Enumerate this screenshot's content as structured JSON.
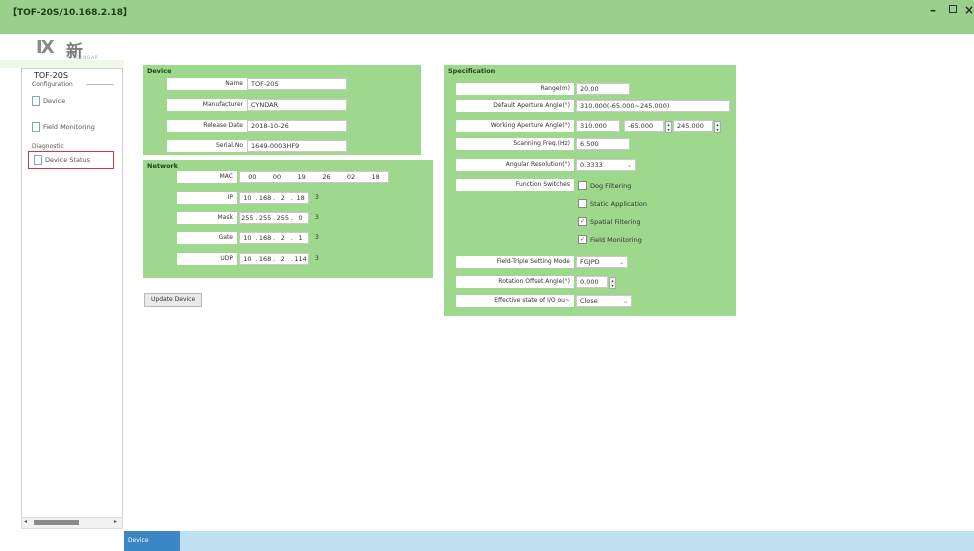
{
  "window": {
    "title": "【TOF-20S/10.168.2.18】",
    "minimize": "–",
    "maximize": "▫",
    "close": "×"
  },
  "logo": {
    "mark": "IX",
    "name": "新达",
    "tagline": "CYNDAR"
  },
  "sidebar": {
    "root": "TOF-20S",
    "group1": "Configuration",
    "items1": [
      {
        "label": "Device"
      },
      {
        "label": "Field Monitoring"
      }
    ],
    "group2": "Diagnostic",
    "items2": [
      {
        "label": "Device Status"
      }
    ]
  },
  "device": {
    "title": "Device",
    "rows": [
      {
        "label": "Name",
        "value": "TOF-20S"
      },
      {
        "label": "Manufacturer",
        "value": "CYNDAR"
      },
      {
        "label": "Release Date",
        "value": "2018-10-26"
      },
      {
        "label": "Serial.No",
        "value": "1649-0003HF9"
      }
    ]
  },
  "network": {
    "title": "Network",
    "mac_label": "MAC",
    "mac": [
      "00",
      "00",
      "19",
      "26",
      "02",
      "18"
    ],
    "rows": [
      {
        "label": "IP",
        "octets": [
          "10",
          "168",
          "2",
          "18"
        ],
        "suffix": "3"
      },
      {
        "label": "Mask",
        "octets": [
          "255",
          "255",
          "255",
          "0"
        ],
        "suffix": "3"
      },
      {
        "label": "Gate",
        "octets": [
          "10",
          "168",
          "2",
          "1"
        ],
        "suffix": "3"
      },
      {
        "label": "UDP",
        "octets": [
          "10",
          "168",
          "2",
          "114"
        ],
        "suffix": "3"
      }
    ]
  },
  "update_button": "Update Device",
  "spec": {
    "title": "Specification",
    "range_label": "Range(m)",
    "range_value": "20.00",
    "aperture_label": "Default Aperture Angle(°)",
    "aperture_value": "310.000(-65.000~245.000)",
    "working_label": "Working Aperture Angle(°)",
    "working_value": "310.000",
    "working_from": "-65.000",
    "working_to": "245.000",
    "freq_label": "Scanning Freq.(Hz)",
    "freq_value": "6.500",
    "resolution_label": "Angular Resolution(°)",
    "resolution_value": "0.3333",
    "switches_label": "Function Switches",
    "switches": [
      {
        "label": "Dog Filtering",
        "checked": false
      },
      {
        "label": "Static Application",
        "checked": false
      },
      {
        "label": "Spatial Filtering",
        "checked": true
      },
      {
        "label": "Field Monitoring",
        "checked": true
      }
    ],
    "trigger_label": "Field-Triple Setting Mode",
    "trigger_value": "FGJPD",
    "offset_label": "Rotation Offset Angle(°)",
    "offset_value": "0.000",
    "effective_label": "Effective state of I/O ou~",
    "effective_value": "Close"
  },
  "status_tab": "Device"
}
